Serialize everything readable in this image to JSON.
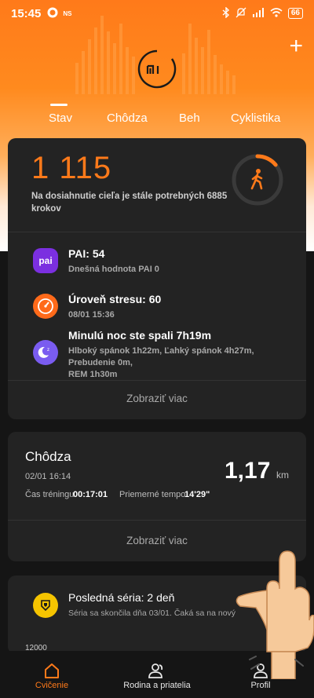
{
  "status_bar": {
    "time": "15:45",
    "ns_label": "NS",
    "battery": "66"
  },
  "header": {
    "plus_label": "+",
    "logo_text": "mi",
    "tabs": [
      {
        "label": "Stav",
        "active": true
      },
      {
        "label": "Chôdza",
        "active": false
      },
      {
        "label": "Beh",
        "active": false
      },
      {
        "label": "Cyklistika",
        "active": false
      }
    ]
  },
  "steps_card": {
    "steps": "1 115",
    "goal_text": "Na dosiahnutie cieľa je stále potrebných 6885 krokov",
    "progress_fraction": 0.14
  },
  "health_card": {
    "pai": {
      "icon_text": "pai",
      "title": "PAI: 54",
      "subtitle": "Dnešná hodnota PAI 0"
    },
    "stress": {
      "title": "Úroveň stresu: 60",
      "subtitle": "08/01 15:36"
    },
    "sleep": {
      "title": "Minulú noc ste spali 7h19m",
      "line1": "Hlboký spánok 1h22m, Ľahký spánok 4h27m,",
      "line2": "Prebudenie 0m,",
      "line3": "REM 1h30m"
    },
    "view_more": "Zobraziť viac"
  },
  "workout_card": {
    "title": "Chôdza",
    "date": "02/01 16:14",
    "distance": "1,17",
    "distance_unit": "km",
    "duration_label": "Čas tréningu",
    "duration_value": "00:17:01",
    "pace_label": "Priemerné tempo",
    "pace_value": "14'29\"",
    "view_more": "Zobraziť viac"
  },
  "streak_card": {
    "title": "Posledná séria: 2 deň",
    "subtitle": "Séria sa skončila dňa 03/01. Čaká sa na nový",
    "bottom_value": "12000"
  },
  "bottom_nav": [
    {
      "label": "Cvičenie",
      "active": true
    },
    {
      "label": "Rodina a priatelia",
      "active": false
    },
    {
      "label": "Profil",
      "active": false
    }
  ],
  "colors": {
    "accent": "#ff7a1a",
    "card": "#232323",
    "pai_purple": "#7b2fe0",
    "sleep_purple": "#7a5cf0",
    "streak_yellow": "#f5c400"
  }
}
